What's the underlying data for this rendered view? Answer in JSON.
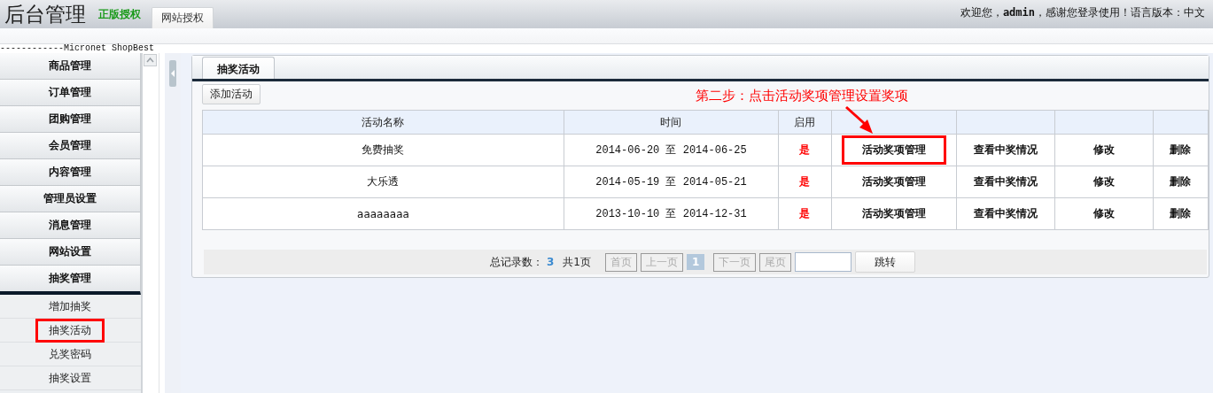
{
  "header": {
    "title": "后台管理",
    "license": "正版授权",
    "license_button": "网站授权",
    "welcome": "欢迎您，**admin**，感谢您登录使用！语言版本：中文"
  },
  "brand_line": "------------Micronet ShopBest",
  "sidebar": {
    "groups": [
      {
        "label": "商品管理",
        "expanded": false
      },
      {
        "label": "订单管理",
        "expanded": false
      },
      {
        "label": "团购管理",
        "expanded": false
      },
      {
        "label": "会员管理",
        "expanded": false
      },
      {
        "label": "内容管理",
        "expanded": false
      },
      {
        "label": "管理员设置",
        "expanded": false
      },
      {
        "label": "消息管理",
        "expanded": false
      },
      {
        "label": "网站设置",
        "expanded": false
      },
      {
        "label": "抽奖管理",
        "expanded": true,
        "children": [
          {
            "label": "增加抽奖",
            "highlighted": false
          },
          {
            "label": "抽奖活动",
            "highlighted": true
          },
          {
            "label": "兑奖密码",
            "highlighted": false
          },
          {
            "label": "抽奖设置",
            "highlighted": false
          }
        ]
      }
    ]
  },
  "tabs": [
    {
      "label": "抽奖活动",
      "selected": true
    }
  ],
  "add_button": "添加活动",
  "annotation": {
    "text": "第二步：点击活动奖项管理设置奖项"
  },
  "table": {
    "columns": [
      "活动名称",
      "时间",
      "启用"
    ],
    "rows": [
      {
        "name": "免费抽奖",
        "time": "2014-06-20 至 2014-06-25",
        "enabled": "是",
        "actions": [
          {
            "label": "活动奖项管理",
            "highlighted": true
          },
          {
            "label": "查看中奖情况",
            "highlighted": false
          },
          {
            "label": "修改",
            "highlighted": false
          },
          {
            "label": "删除",
            "highlighted": false
          }
        ]
      },
      {
        "name": "大乐透",
        "time": "2014-05-19 至 2014-05-21",
        "enabled": "是",
        "actions": [
          {
            "label": "活动奖项管理",
            "highlighted": false
          },
          {
            "label": "查看中奖情况",
            "highlighted": false
          },
          {
            "label": "修改",
            "highlighted": false
          },
          {
            "label": "删除",
            "highlighted": false
          }
        ]
      },
      {
        "name": "aaaaaaaa",
        "time": "2013-10-10 至 2014-12-31",
        "enabled": "是",
        "actions": [
          {
            "label": "活动奖项管理",
            "highlighted": false
          },
          {
            "label": "查看中奖情况",
            "highlighted": false
          },
          {
            "label": "修改",
            "highlighted": false
          },
          {
            "label": "删除",
            "highlighted": false
          }
        ]
      }
    ]
  },
  "pager": {
    "total_label": "总记录数：",
    "total": "3",
    "pages": "共1页",
    "buttons": [
      {
        "label": "首页",
        "kind": "nav",
        "disabled": true
      },
      {
        "label": "上一页",
        "kind": "nav",
        "disabled": true
      },
      {
        "label": "1",
        "kind": "page",
        "selected": true
      },
      {
        "label": "下一页",
        "kind": "nav",
        "disabled": true
      },
      {
        "label": "尾页",
        "kind": "nav",
        "disabled": true
      }
    ],
    "go_button": "跳转"
  }
}
